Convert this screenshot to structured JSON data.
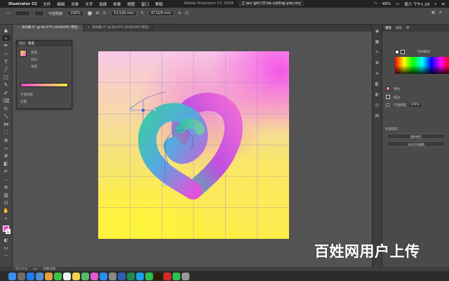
{
  "menubar": {
    "app_name": "Illustrator CC",
    "items": [
      "文件",
      "编辑",
      "对象",
      "文字",
      "选择",
      "效果",
      "视图",
      "窗口",
      "帮助"
    ],
    "window_title": "Adobe Illustrator CC 2018",
    "now_playing": "our girl i'll be calling you my",
    "battery": "48%",
    "clock": "周六 下午1:18"
  },
  "controlbar": {
    "opacity_label": "不透明度:",
    "opacity_value": "100%",
    "x_value": "53.526 mm",
    "y_value": "47.029 mm"
  },
  "tabs": [
    {
      "label": "未标题-4* @ 66.67% (RGB/GPU 预览)",
      "active": true
    },
    {
      "label": "未标题-3* @ 66.67% (RGB/GPU 预览)",
      "active": false
    }
  ],
  "gradient_panel": {
    "tabs": [
      "描边",
      "渐变"
    ],
    "type_label": "类型:",
    "stroke_label": "描边:",
    "angle_label": "角度",
    "location_label": "位置:",
    "opacity_label": "不透明度:"
  },
  "right_panel": {
    "tabs": [
      "属性",
      "图层",
      "库"
    ],
    "hex_value": "FEABD5",
    "fill_label": "填色",
    "stroke_label": "描边",
    "opacity_label": "不透明度",
    "opacity_value": "100%",
    "quick_actions_label": "快速操作",
    "button1": "重新着色",
    "button2": "启动全局编辑"
  },
  "statusbar": {
    "zoom": "66.67%",
    "tool": "切换选择"
  },
  "watermark": "百姓网用户上传",
  "colors": {
    "fill_swatch": "#f04cc4",
    "artboard_pink": "#f650eb",
    "artboard_yellow": "#ffee3a",
    "heart_teal": "#33c2b0",
    "heart_magenta": "#e84ee0"
  },
  "dock_icons": [
    {
      "name": "finder-icon",
      "color": "#3b8ef0"
    },
    {
      "name": "launchpad-icon",
      "color": "#6d6d6d"
    },
    {
      "name": "safari-icon",
      "color": "#1f7bea"
    },
    {
      "name": "mail-icon",
      "color": "#4a90d9"
    },
    {
      "name": "photos-icon",
      "color": "#e8a03c"
    },
    {
      "name": "messages-icon",
      "color": "#39c24a"
    },
    {
      "name": "calendar-icon",
      "color": "#f2f2f2"
    },
    {
      "name": "notes-icon",
      "color": "#f2d24c"
    },
    {
      "name": "maps-icon",
      "color": "#55b96b"
    },
    {
      "name": "itunes-icon",
      "color": "#e45ad0"
    },
    {
      "name": "appstore-icon",
      "color": "#2a8ef0"
    },
    {
      "name": "settings-icon",
      "color": "#8a8a8a"
    },
    {
      "name": "word-icon",
      "color": "#2b5fb8"
    },
    {
      "name": "excel-icon",
      "color": "#1f8a4c"
    },
    {
      "name": "qq-icon",
      "color": "#1aa0ea"
    },
    {
      "name": "wechat-icon",
      "color": "#2bbf4e"
    },
    {
      "name": "illustrator-icon",
      "color": "#331b00"
    },
    {
      "name": "netease-music-icon",
      "color": "#d62a2a"
    },
    {
      "name": "wechat-work-icon",
      "color": "#2bbf4e"
    },
    {
      "name": "trash-icon",
      "color": "#9a9a9a"
    }
  ]
}
